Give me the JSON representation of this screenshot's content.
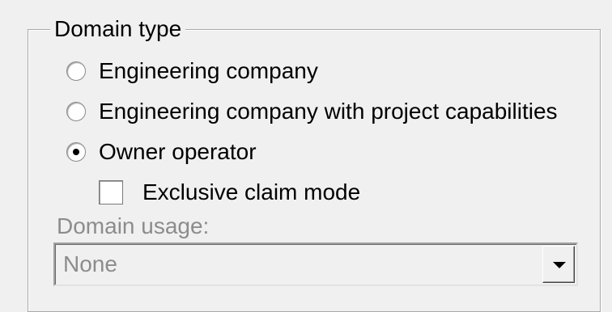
{
  "group": {
    "title": "Domain type"
  },
  "domain_type": {
    "options": [
      {
        "label": "Engineering company",
        "selected": false
      },
      {
        "label": "Engineering company with project capabilities",
        "selected": false
      },
      {
        "label": "Owner operator",
        "selected": true
      }
    ]
  },
  "exclusive_claim": {
    "label": "Exclusive claim mode",
    "checked": false
  },
  "domain_usage": {
    "label": "Domain usage:",
    "value": "None",
    "enabled": false
  }
}
